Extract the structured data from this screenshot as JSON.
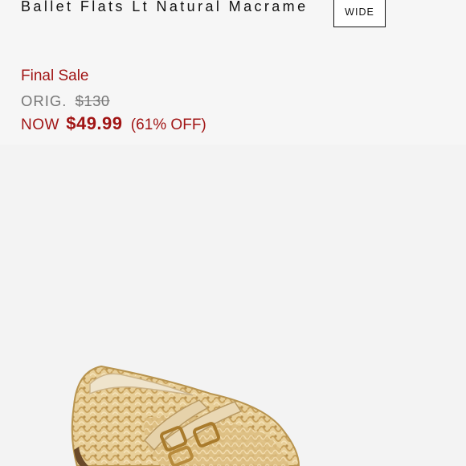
{
  "product": {
    "title": "Ballet Flats Lt Natural Macrame",
    "width_option": "WIDE",
    "sale_tag": "Final Sale",
    "orig_label": "ORIG.",
    "orig_price": "$130",
    "now_label": "NOW",
    "now_price": "$49.99",
    "discount": "(61% OFF)",
    "image_subject": "woven macrame ballet flat with double buckle straps",
    "colors": {
      "sale_red": "#a11515",
      "muted_gray": "#777777",
      "macrame": "#e3c98f",
      "strap": "#e6d3ad",
      "buckle": "#b88b3c"
    }
  }
}
